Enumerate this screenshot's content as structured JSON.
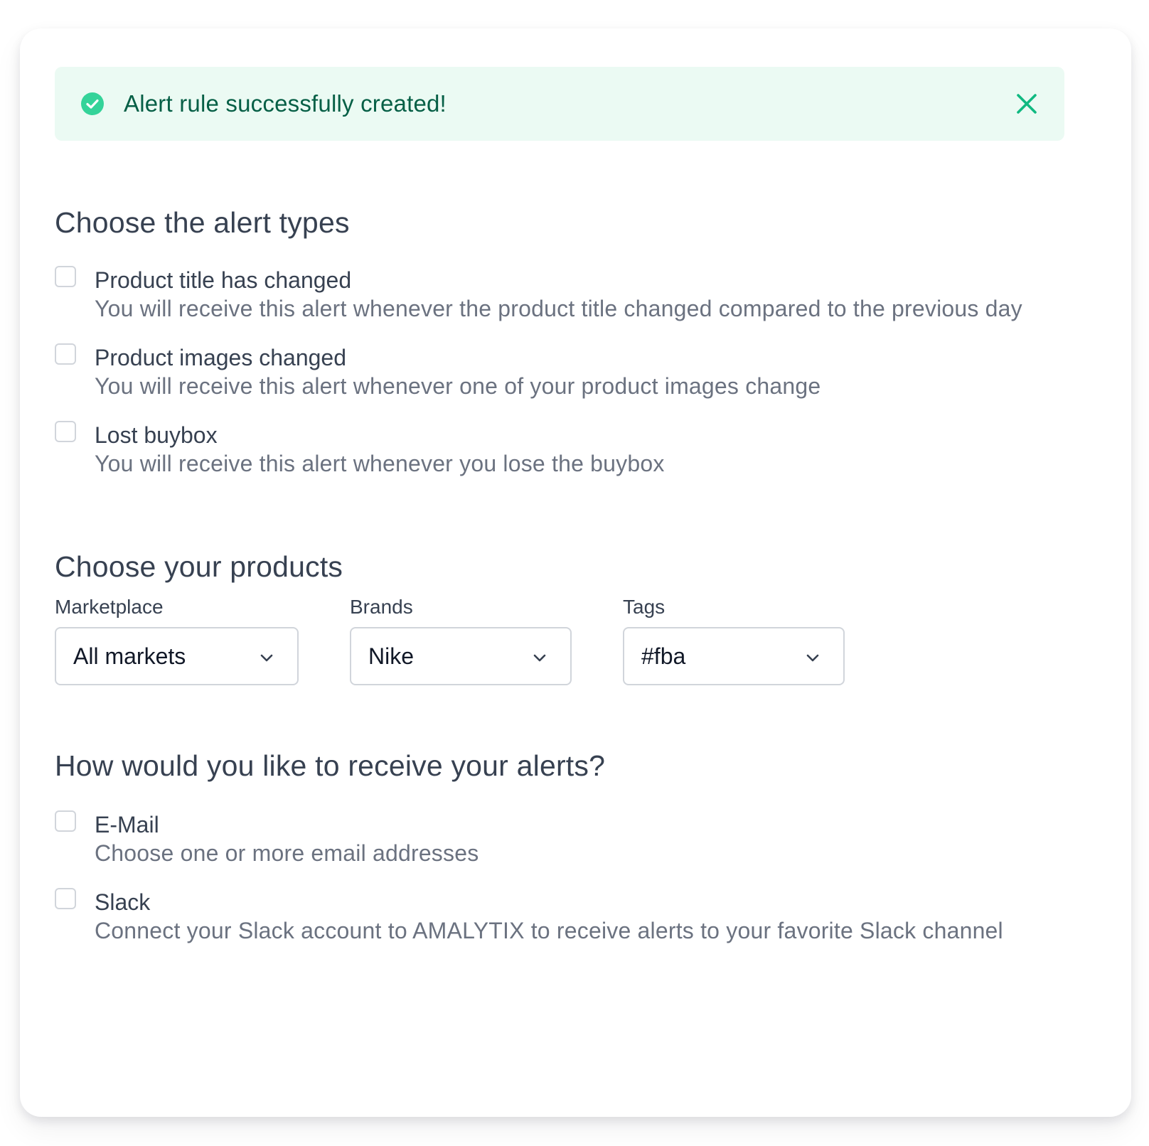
{
  "colors": {
    "success_bg": "#ebfaf3",
    "success_icon": "#34d399",
    "success_text": "#065f46",
    "close_icon": "#10b981",
    "heading": "#374151",
    "muted": "#6b7280",
    "border": "#d1d5db"
  },
  "alert": {
    "icon": "check-circle-icon",
    "message": "Alert rule successfully created!",
    "close_icon": "close-icon"
  },
  "alert_types": {
    "heading": "Choose the alert types",
    "options": [
      {
        "title": "Product title has changed",
        "description": "You will receive this alert whenever the product title changed compared to the previous day",
        "checked": false
      },
      {
        "title": "Product images changed",
        "description": "You will receive this alert whenever one of your product images change",
        "checked": false
      },
      {
        "title": "Lost buybox",
        "description": "You will receive this alert whenever you lose the buybox",
        "checked": false
      }
    ]
  },
  "products": {
    "heading": "Choose your products",
    "fields": [
      {
        "label": "Marketplace",
        "value": "All markets"
      },
      {
        "label": "Brands",
        "value": "Nike"
      },
      {
        "label": "Tags",
        "value": "#fba"
      }
    ]
  },
  "delivery": {
    "heading": "How would you like to receive your alerts?",
    "options": [
      {
        "title": "E-Mail",
        "description": "Choose one or more email addresses",
        "checked": false
      },
      {
        "title": "Slack",
        "description": "Connect your Slack account to AMALYTIX to receive alerts to your favorite Slack channel",
        "checked": false
      }
    ]
  }
}
